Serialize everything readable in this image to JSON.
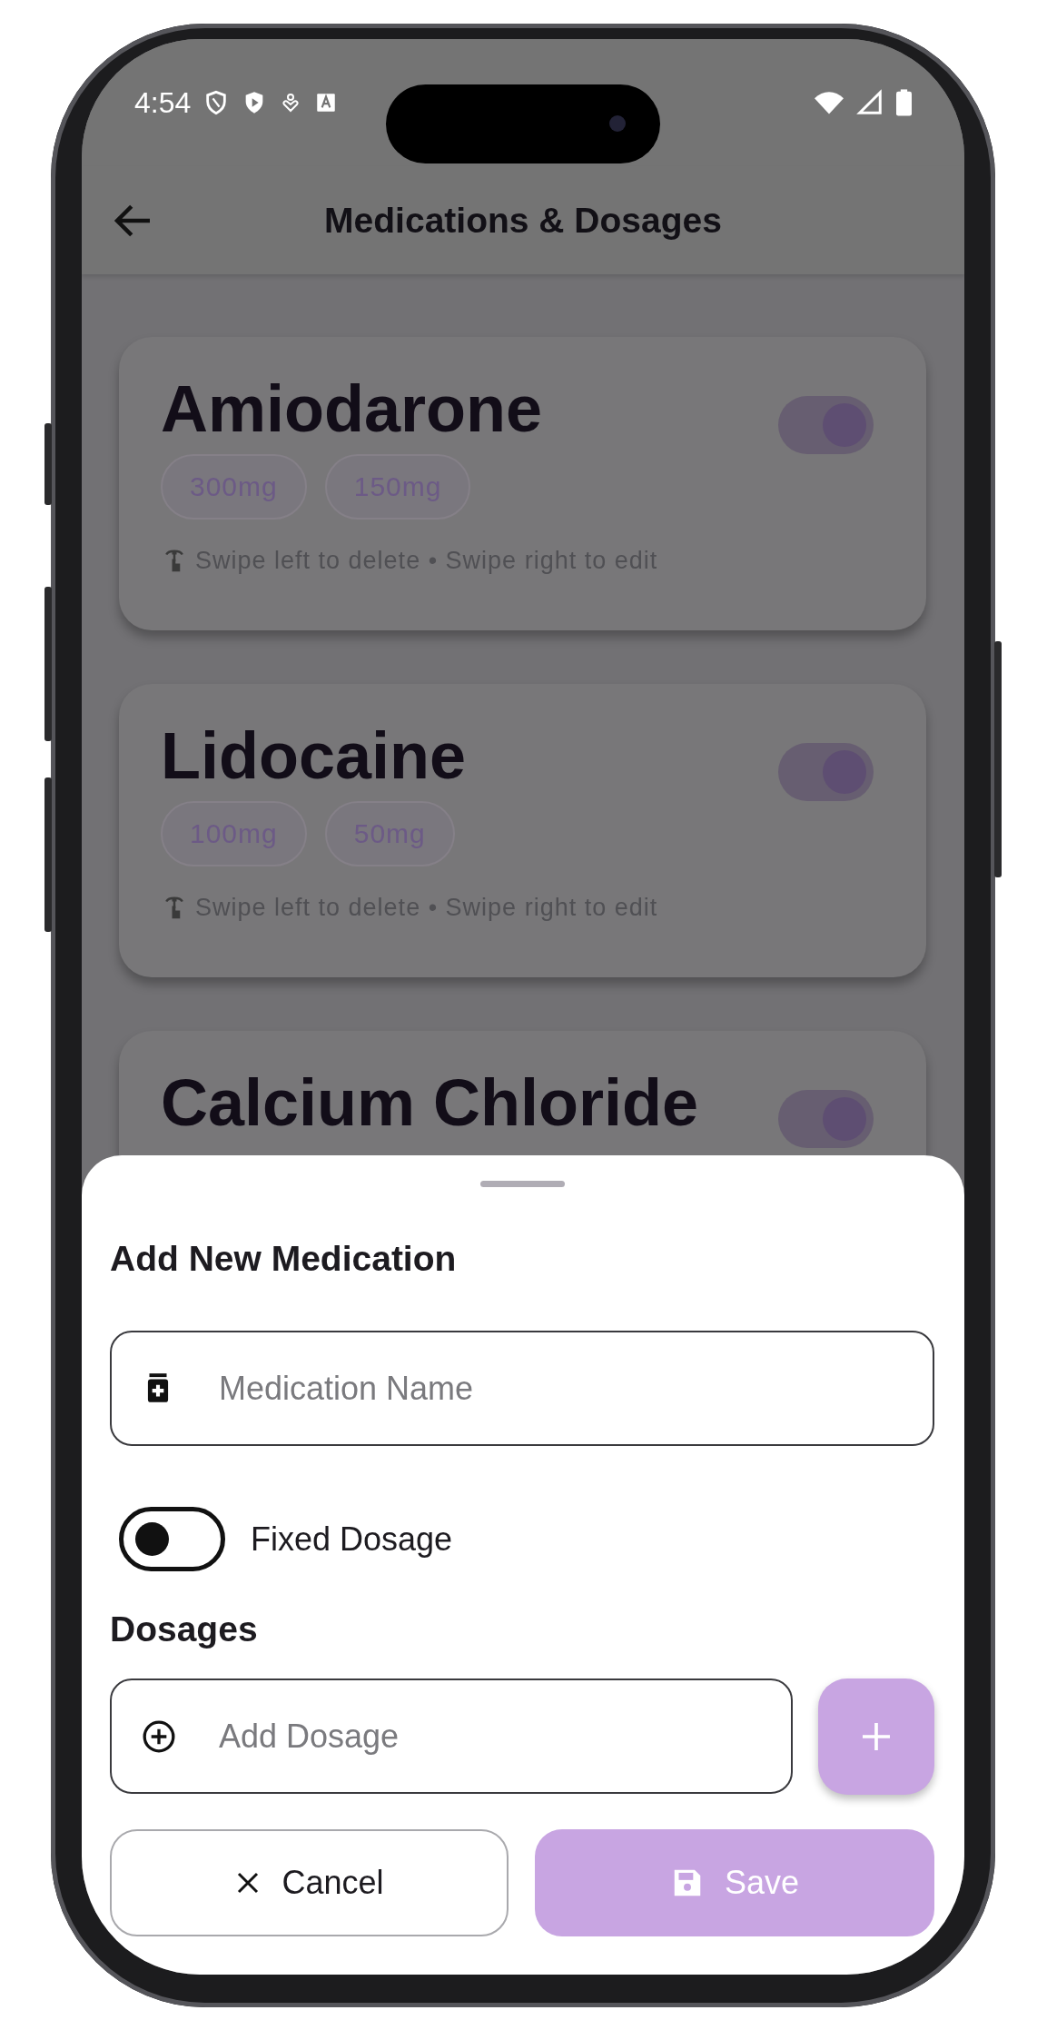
{
  "status_bar": {
    "time": "4:54"
  },
  "app_bar": {
    "title": "Medications & Dosages"
  },
  "medications": [
    {
      "name": "Amiodarone",
      "enabled": true,
      "dosages": [
        "300mg",
        "150mg"
      ],
      "hint": "Swipe left to delete • Swipe right to edit"
    },
    {
      "name": "Lidocaine",
      "enabled": true,
      "dosages": [
        "100mg",
        "50mg"
      ],
      "hint": "Swipe left to delete • Swipe right to edit"
    },
    {
      "name": "Calcium Chloride",
      "enabled": true
    }
  ],
  "sheet": {
    "title": "Add New Medication",
    "name_field": {
      "placeholder": "Medication Name"
    },
    "fixed_dosage": {
      "label": "Fixed Dosage",
      "on": false
    },
    "dosages_heading": "Dosages",
    "dosage_field": {
      "placeholder": "Add Dosage"
    },
    "cancel_button": "Cancel",
    "save_button": "Save"
  }
}
